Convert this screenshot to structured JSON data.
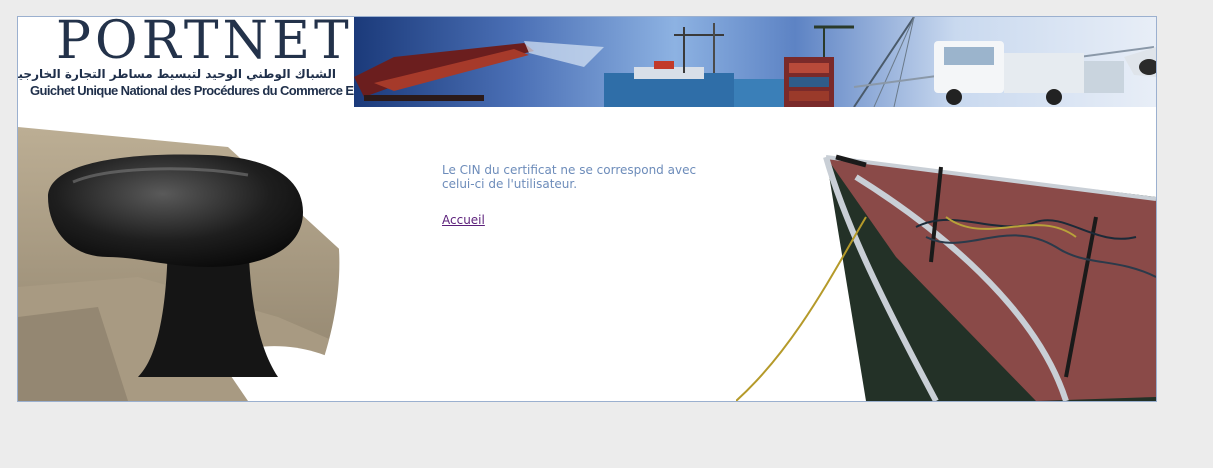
{
  "header": {
    "logo": {
      "word": "PORTNET",
      "arabic": "الشباك الوطني الوحيد لتبسيط مساطر التجارة الخارجية",
      "french": "Guichet Unique National des Procédures du Commerce Extérieur"
    }
  },
  "main": {
    "message": "Le CIN du certificat ne se correspond avec celui-ci de l'utilisateur.",
    "home_link": "Accueil"
  },
  "colors": {
    "page_background": "#ececec",
    "frame_border": "#9bb0cf",
    "message_text": "#6d8cba",
    "link_text": "#5b1f7a"
  }
}
